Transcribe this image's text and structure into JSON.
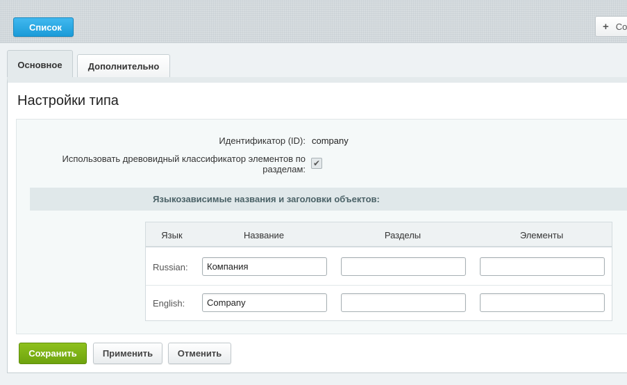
{
  "toolbar": {
    "list_label": "Список",
    "create_label": "Со"
  },
  "tabs": [
    {
      "label": "Основное",
      "active": true
    },
    {
      "label": "Дополнительно",
      "active": false
    }
  ],
  "panel": {
    "title": "Настройки типа",
    "id_label": "Идентификатор (ID):",
    "id_value": "company",
    "tree_label_line1": "Использовать древовидный классификатор элементов по",
    "tree_label_line2": "разделам:",
    "tree_checked": true,
    "section_title": "Языкозависимые названия и заголовки объектов:"
  },
  "lang_table": {
    "headers": [
      "Язык",
      "Название",
      "Разделы",
      "Элементы"
    ],
    "rows": [
      {
        "lang": "Russian:",
        "name": "Компания",
        "sections": "",
        "elements": ""
      },
      {
        "lang": "English:",
        "name": "Company",
        "sections": "",
        "elements": ""
      }
    ]
  },
  "buttons": {
    "save": "Сохранить",
    "apply": "Применить",
    "cancel": "Отменить"
  },
  "colors": {
    "accent_blue": "#1b9bd8",
    "save_green": "#7ab316"
  }
}
